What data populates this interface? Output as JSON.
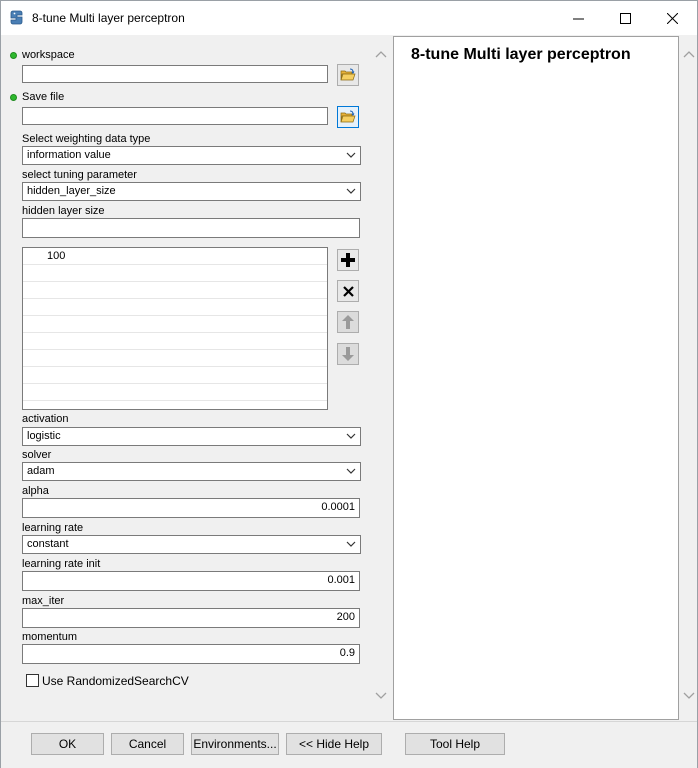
{
  "window": {
    "title": "8-tune Multi layer perceptron"
  },
  "form": {
    "workspace": {
      "label": "workspace",
      "value": ""
    },
    "save_file": {
      "label": "Save file",
      "value": ""
    },
    "weighting": {
      "label": "Select weighting data type",
      "value": "information value"
    },
    "tuning": {
      "label": "select tuning parameter",
      "value": "hidden_layer_size"
    },
    "hidden_layer_size": {
      "label": "hidden layer size",
      "value": ""
    },
    "hidden_list": [
      "100",
      "",
      "",
      "",
      "",
      "",
      "",
      "",
      ""
    ],
    "activation": {
      "label": "activation",
      "value": "logistic"
    },
    "solver": {
      "label": "solver",
      "value": "adam"
    },
    "alpha": {
      "label": "alpha",
      "value": "0.0001"
    },
    "learning_rate": {
      "label": "learning rate",
      "value": "constant"
    },
    "learning_rate_init": {
      "label": "learning rate init",
      "value": "0.001"
    },
    "max_iter": {
      "label": "max_iter",
      "value": "200"
    },
    "momentum": {
      "label": "momentum",
      "value": "0.9"
    },
    "randomized": {
      "label": "Use RandomizedSearchCV",
      "checked": false
    }
  },
  "help": {
    "title": "8-tune Multi layer perceptron"
  },
  "footer": {
    "ok": "OK",
    "cancel": "Cancel",
    "environments": "Environments...",
    "hide_help": "<< Hide Help",
    "tool_help": "Tool Help"
  },
  "colors": {
    "required_dot": "#2eb82e",
    "focus_border": "#0078d7"
  }
}
